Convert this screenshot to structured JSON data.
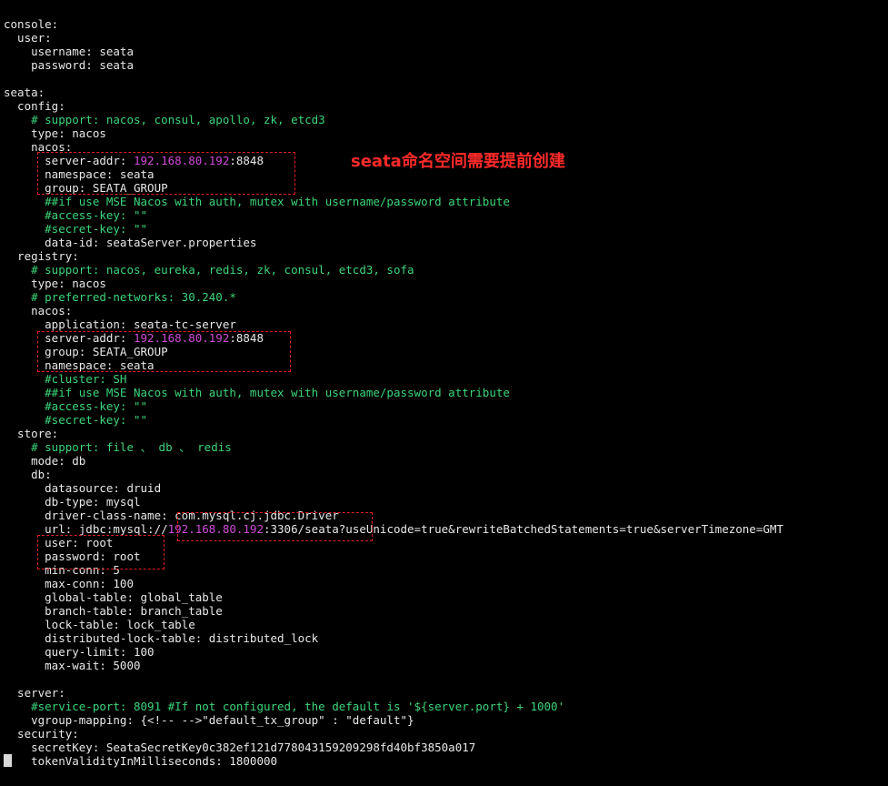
{
  "annotation": "seata命名空间需要提前创建",
  "lines": [
    [
      {
        "t": "console:"
      }
    ],
    [
      {
        "t": "  user:"
      }
    ],
    [
      {
        "t": "    username: seata"
      }
    ],
    [
      {
        "t": "    password: seata"
      }
    ],
    [
      {
        "t": ""
      }
    ],
    [
      {
        "t": "seata:"
      }
    ],
    [
      {
        "t": "  config:"
      }
    ],
    [
      {
        "t": "    # support: nacos, consul, apollo, zk, etcd3",
        "c": "c"
      }
    ],
    [
      {
        "t": "    type: nacos"
      }
    ],
    [
      {
        "t": "    nacos:"
      }
    ],
    [
      {
        "t": "      server-addr: "
      },
      {
        "t": "192.168.80.192",
        "c": "ip"
      },
      {
        "t": ":8848"
      }
    ],
    [
      {
        "t": "      namespace: seata"
      }
    ],
    [
      {
        "t": "      group: SEATA_GROUP"
      }
    ],
    [
      {
        "t": "      ##if use MSE Nacos with auth, mutex with username/password attribute",
        "c": "c"
      }
    ],
    [
      {
        "t": "      #access-key: \"\"",
        "c": "c"
      }
    ],
    [
      {
        "t": "      #secret-key: \"\"",
        "c": "c"
      }
    ],
    [
      {
        "t": "      data-id: seataServer.properties"
      }
    ],
    [
      {
        "t": "  registry:"
      }
    ],
    [
      {
        "t": "    # support: nacos, eureka, redis, zk, consul, etcd3, sofa",
        "c": "c"
      }
    ],
    [
      {
        "t": "    type: nacos"
      }
    ],
    [
      {
        "t": "    # preferred-networks: 30.240.*",
        "c": "c"
      }
    ],
    [
      {
        "t": "    nacos:"
      }
    ],
    [
      {
        "t": "      application: seata-tc-server"
      }
    ],
    [
      {
        "t": "      server-addr: "
      },
      {
        "t": "192.168.80.192",
        "c": "ip"
      },
      {
        "t": ":8848"
      }
    ],
    [
      {
        "t": "      group: SEATA_GROUP"
      }
    ],
    [
      {
        "t": "      namespace: seata"
      }
    ],
    [
      {
        "t": "      #cluster: SH",
        "c": "c"
      }
    ],
    [
      {
        "t": "      ##if use MSE Nacos with auth, mutex with username/password attribute",
        "c": "c"
      }
    ],
    [
      {
        "t": "      #access-key: \"\"",
        "c": "c"
      }
    ],
    [
      {
        "t": "      #secret-key: \"\"",
        "c": "c"
      }
    ],
    [
      {
        "t": "  store:"
      }
    ],
    [
      {
        "t": "    # support: file 、 db 、 redis",
        "c": "c"
      }
    ],
    [
      {
        "t": "    mode: db"
      }
    ],
    [
      {
        "t": "    db:"
      }
    ],
    [
      {
        "t": "      datasource: druid"
      }
    ],
    [
      {
        "t": "      db-type: mysql"
      }
    ],
    [
      {
        "t": "      driver-class-name: com.mysql.cj.jdbc.Driver"
      }
    ],
    [
      {
        "t": "      url: jdbc:mysql://"
      },
      {
        "t": "192.168.80.192",
        "c": "ip"
      },
      {
        "t": ":3306/seata?useUnicode=true&rewriteBatchedStatements=true&serverTimezone=GMT"
      }
    ],
    [
      {
        "t": "      user: root"
      }
    ],
    [
      {
        "t": "      password: root"
      }
    ],
    [
      {
        "t": "      min-conn: 5"
      }
    ],
    [
      {
        "t": "      max-conn: 100"
      }
    ],
    [
      {
        "t": "      global-table: global_table"
      }
    ],
    [
      {
        "t": "      branch-table: branch_table"
      }
    ],
    [
      {
        "t": "      lock-table: lock_table"
      }
    ],
    [
      {
        "t": "      distributed-lock-table: distributed_lock"
      }
    ],
    [
      {
        "t": "      query-limit: 100"
      }
    ],
    [
      {
        "t": "      max-wait: 5000"
      }
    ],
    [
      {
        "t": ""
      }
    ],
    [
      {
        "t": "  server:"
      }
    ],
    [
      {
        "t": "    #service-port: 8091 #If not configured, the default is '${server.port} + 1000'",
        "c": "c"
      }
    ],
    [
      {
        "t": "    vgroup-mapping: {<!-- -->\"default_tx_group\" : \"default\"}"
      }
    ],
    [
      {
        "t": "  security:"
      }
    ],
    [
      {
        "t": "    secretKey: SeataSecretKey0c382ef121d778043159209298fd40bf3850a017"
      }
    ],
    [
      {
        "t": "    tokenValidityInMilliseconds: 1800000"
      }
    ]
  ]
}
